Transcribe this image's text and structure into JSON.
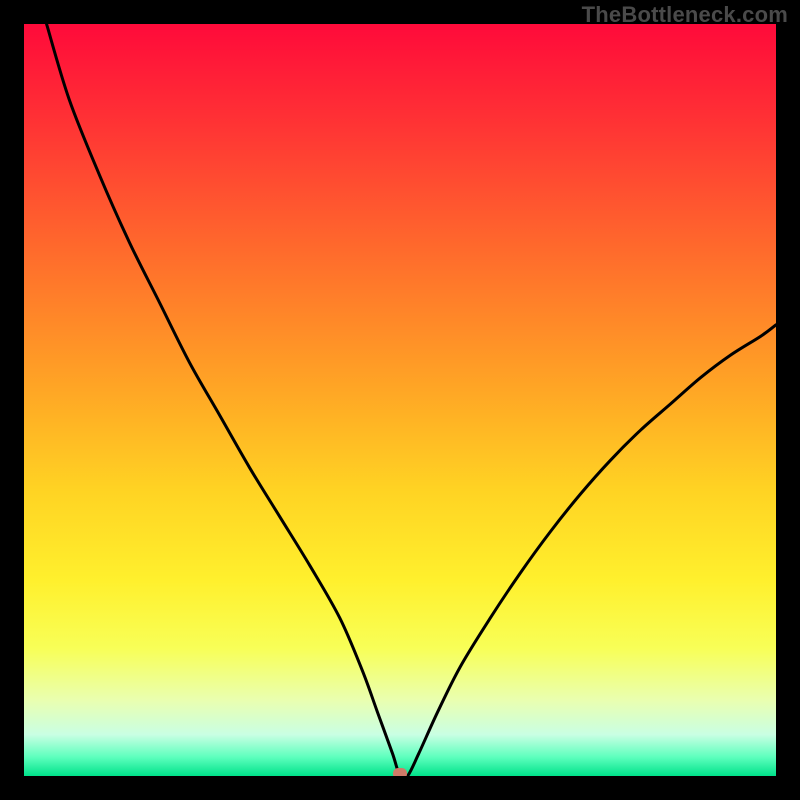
{
  "watermark": "TheBottleneck.com",
  "colors": {
    "frame": "#000000",
    "curve": "#000000",
    "marker": "#cf7a68",
    "gradient_stops": [
      {
        "offset": 0.0,
        "color": "#ff0a3a"
      },
      {
        "offset": 0.12,
        "color": "#ff2f35"
      },
      {
        "offset": 0.3,
        "color": "#ff6a2c"
      },
      {
        "offset": 0.48,
        "color": "#ffa425"
      },
      {
        "offset": 0.62,
        "color": "#ffd323"
      },
      {
        "offset": 0.74,
        "color": "#fff02d"
      },
      {
        "offset": 0.83,
        "color": "#f8ff57"
      },
      {
        "offset": 0.9,
        "color": "#e9ffb1"
      },
      {
        "offset": 0.945,
        "color": "#c9ffe3"
      },
      {
        "offset": 0.975,
        "color": "#5dffbd"
      },
      {
        "offset": 1.0,
        "color": "#00e28a"
      }
    ]
  },
  "chart_data": {
    "type": "line",
    "title": "",
    "xlabel": "",
    "ylabel": "",
    "xlim": [
      0,
      100
    ],
    "ylim": [
      0,
      100
    ],
    "grid": false,
    "legend": false,
    "marker": {
      "x": 50,
      "y": 0
    },
    "series": [
      {
        "name": "curve",
        "x": [
          3,
          6,
          10,
          14,
          18,
          22,
          26,
          30,
          34,
          38,
          42,
          45,
          47,
          49,
          50,
          51,
          52.5,
          55,
          58,
          62,
          66,
          70,
          74,
          78,
          82,
          86,
          90,
          94,
          98,
          100
        ],
        "y": [
          100,
          90,
          80,
          71,
          63,
          55,
          48,
          41,
          34.5,
          28,
          21,
          14,
          8.5,
          3,
          0,
          0,
          3,
          8.5,
          14.5,
          21,
          27,
          32.5,
          37.5,
          42,
          46,
          49.5,
          53,
          56,
          58.5,
          60
        ]
      }
    ]
  }
}
